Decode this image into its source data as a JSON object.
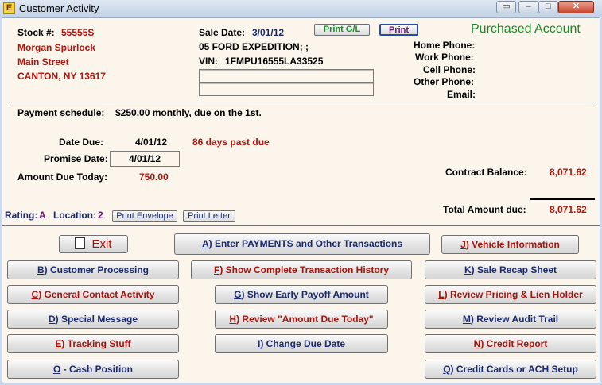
{
  "window": {
    "title": "Customer Activity",
    "icon_name": "app-logo-icon",
    "controls": [
      "restore-down-icon",
      "minimize-icon",
      "maximize-icon",
      "close-icon"
    ]
  },
  "customer": {
    "stock_label": "Stock #:",
    "stock_number": "55555S",
    "name": "Morgan Spurlock",
    "street": "Main Street",
    "city_state_zip": "CANTON, NY 13617"
  },
  "sale": {
    "date_label": "Sale Date:",
    "date_value": "3/01/12",
    "vehicle": "05 FORD EXPEDITION; ;",
    "vin_label": "VIN:",
    "vin_value": "1FMPU16555LA33525",
    "extra_field_1": "",
    "extra_field_2": ""
  },
  "header_buttons": {
    "print_gl": "Print G/L",
    "print": "Print"
  },
  "status": "Purchased Account",
  "contact": {
    "home_phone_label": "Home Phone:",
    "work_phone_label": "Work Phone:",
    "cell_phone_label": "Cell Phone:",
    "other_phone_label": "Other Phone:",
    "email_label": "Email:"
  },
  "payment": {
    "schedule_label": "Payment schedule:",
    "schedule_value": "$250.00 monthly, due on the 1st.",
    "date_due_label": "Date Due:",
    "date_due_value": "4/01/12",
    "past_due": "86 days past due",
    "promise_date_label": "Promise Date:",
    "promise_date_value": "4/01/12",
    "amount_due_label": "Amount Due Today:",
    "amount_due_value": "750.00"
  },
  "balances": {
    "contract_label": "Contract Balance:",
    "contract_value": "8,071.62",
    "total_label": "Total Amount due:",
    "total_value": "8,071.62"
  },
  "rating": {
    "rating_label": "Rating:",
    "rating_value": "A",
    "location_label": "Location:",
    "location_value": "2",
    "print_envelope": "Print Envelope",
    "print_letter": "Print Letter"
  },
  "actions": {
    "exit": {
      "label": "Exit",
      "icon": "exit-door-icon"
    },
    "a": {
      "key": "A",
      "label": ") Enter PAYMENTS and Other Transactions"
    },
    "j": {
      "key": "J",
      "label": ") Vehicle Information"
    },
    "b": {
      "key": "B",
      "label": ") Customer Processing"
    },
    "f": {
      "key": "F",
      "label": ") Show Complete Transaction History"
    },
    "k": {
      "key": "K",
      "label": ") Sale Recap Sheet"
    },
    "c": {
      "key": "C",
      "label": ") General Contact Activity"
    },
    "g": {
      "key": "G",
      "label": ") Show Early Payoff Amount"
    },
    "l": {
      "key": "L",
      "label": ") Review Pricing & Lien Holder"
    },
    "d": {
      "key": "D",
      "label": ") Special Message"
    },
    "h": {
      "key": "H",
      "label": ") Review \"Amount Due Today\""
    },
    "m": {
      "key": "M",
      "label": ") Review Audit Trail"
    },
    "e": {
      "key": "E",
      "label": ") Tracking Stuff"
    },
    "i": {
      "key": "I",
      "label": ") Change Due Date"
    },
    "n": {
      "key": "N",
      "label": ") Credit Report"
    },
    "o": {
      "key": "O",
      "label": " - Cash Position"
    },
    "q": {
      "key": "Q",
      "label": ") Credit Cards or ACH Setup"
    }
  }
}
